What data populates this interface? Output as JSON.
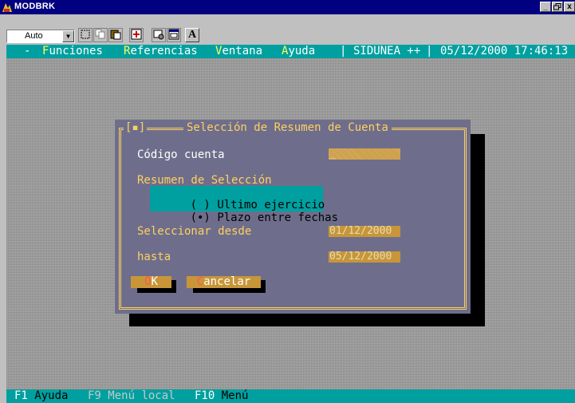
{
  "window": {
    "title": "MODBRK",
    "min": "_",
    "max": "°",
    "close": "x"
  },
  "toolbar": {
    "font_select_value": "Auto",
    "a_label": "A"
  },
  "menu": {
    "dash": "-",
    "items": [
      {
        "hot": "F",
        "rest": "unciones"
      },
      {
        "hot": "R",
        "rest": "eferencias"
      },
      {
        "hot": "V",
        "rest": "entana"
      },
      {
        "hot": "A",
        "rest": "yuda"
      }
    ],
    "separator1": "|",
    "system": "SIDUNEA ++",
    "separator2": "|",
    "datetime": "05/12/2000 17:46:13"
  },
  "dialog": {
    "close_box": "[▪]",
    "title": "Selección de Resumen de Cuenta",
    "codigo_label": "Código cuenta",
    "codigo_value": "_",
    "resumen_label": "Resumen de Selección",
    "options": [
      {
        "mark": "( )",
        "label": "Ultimo ejercicio"
      },
      {
        "mark": "(•)",
        "label": "Plazo entre fechas"
      }
    ],
    "desde_label": "Seleccionar desde",
    "desde_value": "01/12/2000",
    "hasta_label": "hasta",
    "hasta_value": "05/12/2000",
    "ok": {
      "hot": "O",
      "rest": "K"
    },
    "cancel": {
      "hot": "C",
      "rest": "ancelar"
    }
  },
  "status": {
    "f1_key": "F1",
    "f1_label": "Ayuda",
    "f9_key": "F9",
    "f9_label": "Menú local",
    "f10_key": "F10",
    "f10_label": "Menú"
  },
  "colors": {
    "title_bar": "#000080",
    "cyan": "#00a0a0",
    "dialog": "#6e6e8c",
    "frame": "#ffd060",
    "field": "#c89638"
  }
}
